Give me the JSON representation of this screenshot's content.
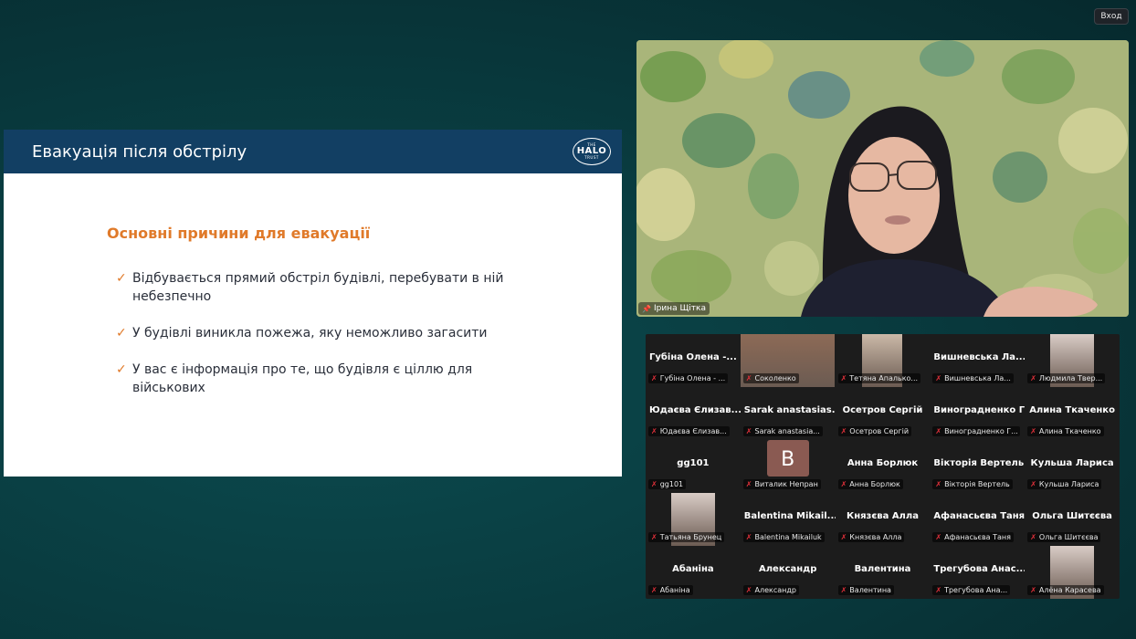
{
  "topbar": {
    "enter_label": "Вход"
  },
  "slide": {
    "title": "Евакуація після обстрілу",
    "logo": {
      "top": "THE",
      "mid": "HALO",
      "bottom": "TRUST"
    },
    "subtitle": "Основні причини для евакуації",
    "bullets": [
      "Відбувається прямий обстріл будівлі, перебувати в ній небезпечно",
      "У будівлі виникла пожежа, яку неможливо загасити",
      "У вас є інформація про те, що будівля є ціллю для військових"
    ],
    "colors": {
      "header": "#123f63",
      "accent": "#e07a2a"
    }
  },
  "speaker": {
    "name": "Ірина Щітка"
  },
  "gallery": {
    "tiles": [
      {
        "name": "Губіна Олена -...",
        "label": "Губіна Олена - ..."
      },
      {
        "name": "",
        "label": "Соколенко",
        "video": "wide"
      },
      {
        "name": "",
        "label": "Тетяна Апалько...",
        "video": "narrow"
      },
      {
        "name": "Вишневська Ла...",
        "label": "Вишневська Ла..."
      },
      {
        "name": "",
        "label": "Людмила Твер...",
        "video": "mid"
      },
      {
        "name": "Юдаєва Єлизав...",
        "label": "Юдаєва Єлизав..."
      },
      {
        "name": "Sarak anastasias...",
        "label": "Sarak anastasia..."
      },
      {
        "name": "Осетров Сергій",
        "label": "Осетров Сергій"
      },
      {
        "name": "Виноградненко Г...",
        "label": "Виноградненко Г..."
      },
      {
        "name": "Алина Ткаченко",
        "label": "Алина Ткаченко"
      },
      {
        "name": "gg101",
        "label": "gg101"
      },
      {
        "name": "",
        "label": "Виталик Непран",
        "avatar": "B"
      },
      {
        "name": "Анна Борлюк",
        "label": "Анна Борлюк"
      },
      {
        "name": "Вікторія Вертель",
        "label": "Вікторія Вертель"
      },
      {
        "name": "Кульша Лариса",
        "label": "Кульша Лариса"
      },
      {
        "name": "",
        "label": "Татьяна Брунец",
        "video": "mid"
      },
      {
        "name": "Balentina Mikail...",
        "label": "Balentina Mikailuk"
      },
      {
        "name": "Князєва Алла",
        "label": "Князєва Алла"
      },
      {
        "name": "Афанасьєва Таня",
        "label": "Афанасьєва Таня"
      },
      {
        "name": "Ольга Шитєєва",
        "label": "Ольга Шитєєва"
      },
      {
        "name": "Абаніна",
        "label": "Абаніна"
      },
      {
        "name": "Александр",
        "label": "Александр"
      },
      {
        "name": "Валентина",
        "label": "Валентина"
      },
      {
        "name": "Трегубова Анас...",
        "label": "Трегубова Ана..."
      },
      {
        "name": "",
        "label": "Алёна Карасева",
        "video": "mid"
      }
    ]
  }
}
